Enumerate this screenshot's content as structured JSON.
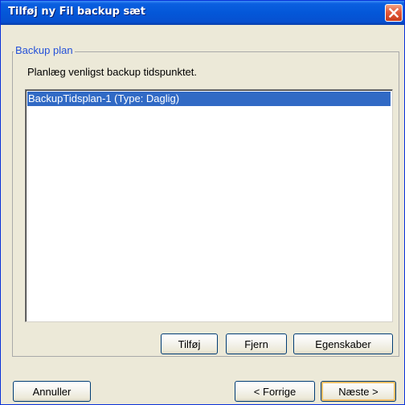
{
  "window": {
    "title": "Tilføj ny Fil backup sæt",
    "close_icon": "close-icon"
  },
  "group": {
    "legend": "Backup plan",
    "instruction": "Planlæg venligst backup tidspunktet."
  },
  "schedule_list": {
    "items": [
      {
        "label": "BackupTidsplan-1 (Type: Daglig)",
        "selected": true
      }
    ]
  },
  "list_buttons": {
    "add": "Tilføj",
    "remove": "Fjern",
    "properties": "Egenskaber"
  },
  "footer": {
    "cancel": "Annuller",
    "previous": "< Forrige",
    "next": "Næste >"
  },
  "colors": {
    "titlebar": "#0457d8",
    "selection": "#316ac5",
    "legend_text": "#2450d8",
    "close_button": "#e3593a",
    "window_face": "#ece9d8"
  }
}
